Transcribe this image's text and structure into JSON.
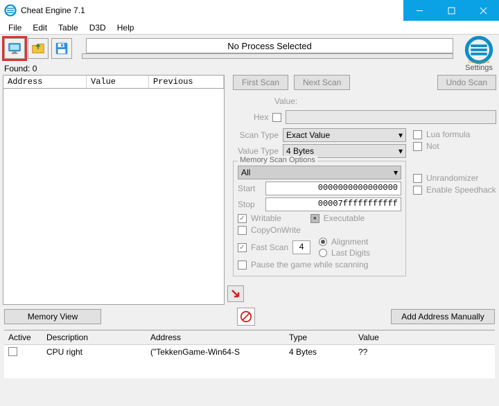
{
  "titlebar": {
    "title": "Cheat Engine 7.1"
  },
  "menubar": {
    "items": [
      "File",
      "Edit",
      "Table",
      "D3D",
      "Help"
    ]
  },
  "toolbar": {
    "process_label": "No Process Selected",
    "settings_label": "Settings"
  },
  "found": {
    "label": "Found:",
    "count": 0
  },
  "results_headers": {
    "addr": "Address",
    "val": "Value",
    "prev": "Previous"
  },
  "scan": {
    "first_scan": "First Scan",
    "next_scan": "Next Scan",
    "undo_scan": "Undo Scan",
    "value_label": "Value:",
    "hex_label": "Hex",
    "scan_type_label": "Scan Type",
    "scan_type_value": "Exact Value",
    "value_type_label": "Value Type",
    "value_type_value": "4 Bytes",
    "lua_formula": "Lua formula",
    "not": "Not",
    "mem_legend": "Memory Scan Options",
    "mem_all": "All",
    "start_label": "Start",
    "start_value": "0000000000000000",
    "stop_label": "Stop",
    "stop_value": "00007fffffffffff",
    "writable": "Writable",
    "executable": "Executable",
    "copyonwrite": "CopyOnWrite",
    "fast_scan": "Fast Scan",
    "fast_scan_val": "4",
    "alignment": "Alignment",
    "last_digits": "Last Digits",
    "pause": "Pause the game while scanning",
    "unrandomizer": "Unrandomizer",
    "speedhack": "Enable Speedhack"
  },
  "midbar": {
    "memory_view": "Memory View",
    "add_manual": "Add Address Manually"
  },
  "table": {
    "headers": {
      "active": "Active",
      "desc": "Description",
      "addr": "Address",
      "type": "Type",
      "value": "Value"
    },
    "rows": [
      {
        "desc": "CPU right",
        "addr": "(\"TekkenGame-Win64-S",
        "type": "4 Bytes",
        "value": "??"
      }
    ]
  }
}
